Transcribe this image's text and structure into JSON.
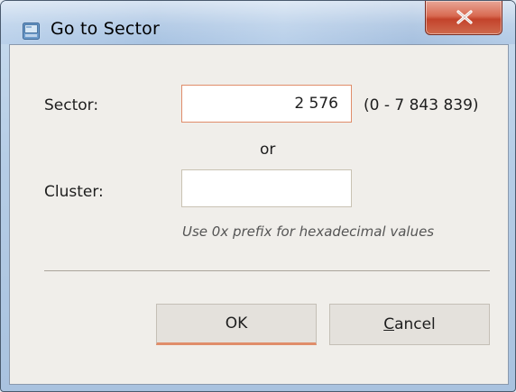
{
  "window": {
    "title": "Go to Sector",
    "icon": "drive-icon",
    "close_glyph": "X"
  },
  "form": {
    "sector_label": "Sector:",
    "sector_value": "2 576",
    "sector_range": "(0 - 7 843 839)",
    "or_text": "or",
    "cluster_label": "Cluster:",
    "cluster_value": "",
    "hint": "Use 0x prefix for hexadecimal values"
  },
  "buttons": {
    "ok_label": "OK",
    "cancel_access_key": "C",
    "cancel_rest": "ancel"
  },
  "colors": {
    "focus_accent": "#e08d6a",
    "close_button": "#c3432b",
    "dialog_background": "#f0eeea"
  }
}
